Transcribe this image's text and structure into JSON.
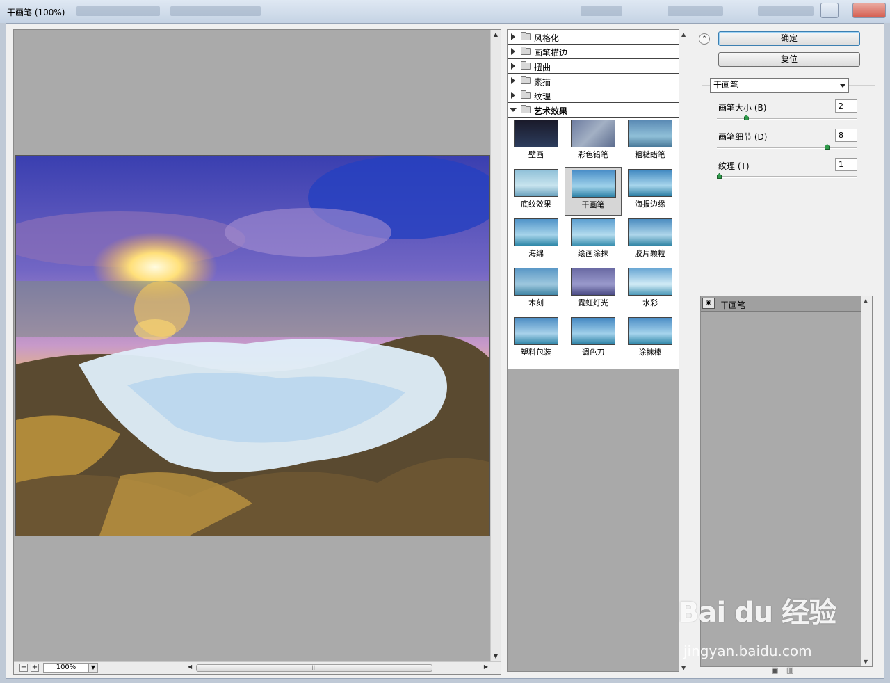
{
  "window": {
    "title": "干画笔 (100%)"
  },
  "preview": {
    "zoom": "100%",
    "zoom_out": "−",
    "zoom_in": "+"
  },
  "filter_gallery": {
    "categories": [
      {
        "label": "风格化",
        "expanded": false
      },
      {
        "label": "画笔描边",
        "expanded": false
      },
      {
        "label": "扭曲",
        "expanded": false
      },
      {
        "label": "素描",
        "expanded": false
      },
      {
        "label": "纹理",
        "expanded": false
      },
      {
        "label": "艺术效果",
        "expanded": true
      }
    ],
    "effects": [
      {
        "label": "壁画"
      },
      {
        "label": "彩色铅笔"
      },
      {
        "label": "粗糙蜡笔"
      },
      {
        "label": "底纹效果"
      },
      {
        "label": "干画笔",
        "selected": true
      },
      {
        "label": "海报边缘"
      },
      {
        "label": "海绵"
      },
      {
        "label": "绘画涂抹"
      },
      {
        "label": "胶片颗粒"
      },
      {
        "label": "木刻"
      },
      {
        "label": "霓虹灯光"
      },
      {
        "label": "水彩"
      },
      {
        "label": "塑料包装"
      },
      {
        "label": "调色刀"
      },
      {
        "label": "涂抹棒"
      }
    ]
  },
  "controls": {
    "ok_label": "确定",
    "reset_label": "复位",
    "collapse_icon": "double-chevron-up-icon",
    "filter_select": "干画笔",
    "params": [
      {
        "label": "画笔大小 (B)",
        "value": "2",
        "fraction": 0.2
      },
      {
        "label": "画笔细节 (D)",
        "value": "8",
        "fraction": 0.8
      },
      {
        "label": "纹理 (T)",
        "value": "1",
        "fraction": 0.0
      }
    ]
  },
  "layers": [
    {
      "name": "干画笔"
    }
  ],
  "watermark": {
    "brand": "Bai du 经验",
    "url": "jingyan.baidu.com"
  }
}
